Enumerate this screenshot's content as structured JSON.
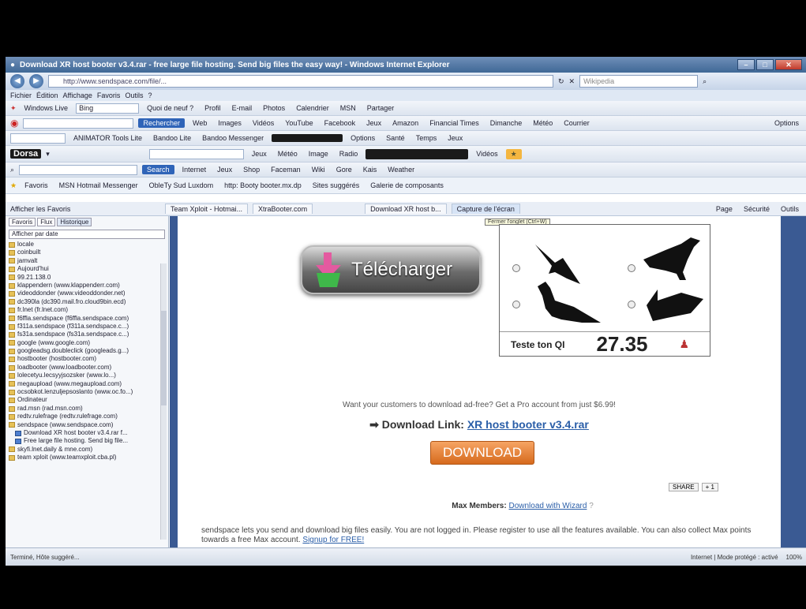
{
  "window": {
    "title": "Download XR host booter v3.4.rar - free large file hosting. Send big files the easy way! - Windows Internet Explorer",
    "controls": [
      "–",
      "□",
      "✕"
    ]
  },
  "address": {
    "url": "http://www.sendspace.com/file/...",
    "search_placeholder": "Wikipedia"
  },
  "menu": [
    "Fichier",
    "Édition",
    "Affichage",
    "Favoris",
    "Outils",
    "?"
  ],
  "toolbars": {
    "row1": [
      "Windows Live",
      "Bing",
      "Quoi de neuf ?",
      "Profil",
      "E-mail",
      "Photos",
      "Calendrier",
      "MSN",
      "Partager"
    ],
    "row2": [
      "Rechercher",
      "Web",
      "Images",
      "Vidéos",
      "YouTube",
      "Facebook",
      "Jeux",
      "Amazon",
      "Financial Times",
      "Dimanche",
      "Météo",
      "Courrier",
      "Options"
    ],
    "row3": [
      "ANIMATOR Tools Lite",
      "Bandoo Lite",
      "Bandoo Messenger",
      "Options",
      "Santé",
      "Temps",
      "Jeux"
    ],
    "brand": "Dorsa",
    "row4": [
      "Jeux",
      "Météo",
      "Image",
      "Radio",
      "Vidéos"
    ],
    "row5": [
      "Search",
      "Internet",
      "Jeux",
      "Shop",
      "Faceman",
      "Wiki",
      "Gore",
      "Kais",
      "Weather"
    ]
  },
  "favorites_bar": {
    "label": "Favoris",
    "items": [
      "MSN Hotmail Messenger",
      "ObleTy Sud Luxdom",
      "http: Booty booter.mx.dp",
      "Sites suggérés",
      "Galerie de composants"
    ]
  },
  "tabs": [
    "Team Xploit - Hotmai...",
    "XtraBooter.com",
    "Download XR host b...",
    "Capture de l'écran"
  ],
  "tab_actions": [
    "Page",
    "Sécurité",
    "Outils"
  ],
  "tooltip": "Fermer l'onglet (Ctrl+W)",
  "sidebar": {
    "title": "Afficher les Favoris",
    "tabs": [
      "Favoris",
      "Flux",
      "Historique"
    ],
    "view": "Afficher par date",
    "history": [
      {
        "text": "locale",
        "type": "folder"
      },
      {
        "text": "coinbuilt",
        "type": "folder"
      },
      {
        "text": "jamvalt",
        "type": "folder"
      },
      {
        "text": "Aujourd'hui",
        "type": "folder"
      },
      {
        "text": "99.21.138.0",
        "type": "folder"
      },
      {
        "text": "klappendern (www.klappenderr.com)",
        "type": "folder"
      },
      {
        "text": "videoddonder (www.videoddonder.net)",
        "type": "folder"
      },
      {
        "text": "dc390la (dc390.mail.fro.cloud9bin.ecd)",
        "type": "folder"
      },
      {
        "text": "fr.lnet (fr.lnet.com)",
        "type": "folder"
      },
      {
        "text": "f6ffla.sendspace (f6ffla.sendspace.com)",
        "type": "folder"
      },
      {
        "text": "f311a.sendspace (f311a.sendspace.c...)",
        "type": "folder"
      },
      {
        "text": "fs31a.sendspace (fs31a.sendspace.c...)",
        "type": "folder"
      },
      {
        "text": "google (www.google.com)",
        "type": "folder"
      },
      {
        "text": "googleadsg.doubleclick (googleads.g...)",
        "type": "folder"
      },
      {
        "text": "hostbooter (hostbooter.com)",
        "type": "folder"
      },
      {
        "text": "loadbooter (www.loadbooter.com)",
        "type": "folder"
      },
      {
        "text": "lolecetyu.lecsyyjsozsker (www.lo...)",
        "type": "folder"
      },
      {
        "text": "megaupload (www.megaupload.com)",
        "type": "folder"
      },
      {
        "text": "ocsobkot.lenzuljepsoslanto (www.oc.fo...)",
        "type": "folder"
      },
      {
        "text": "Ordinateur",
        "type": "folder"
      },
      {
        "text": "rad.msn (rad.msn.com)",
        "type": "folder"
      },
      {
        "text": "redtv.rulefrage (redtv.rulefrage.com)",
        "type": "folder"
      },
      {
        "text": "sendspace (www.sendspace.com)",
        "type": "folder"
      },
      {
        "text": "Download XR host booter v3.4.rar f...",
        "type": "page"
      },
      {
        "text": "Free large file hosting. Send big file...",
        "type": "page"
      },
      {
        "text": "skyfi.lnet.daily & mne.com)",
        "type": "folder"
      },
      {
        "text": "team xploit (www.teamxploit.cba.pl)",
        "type": "folder"
      }
    ],
    "status": "Terminé, Hôte suggéré..."
  },
  "page": {
    "telecharger_label": "Télécharger",
    "captcha_label": "Teste ton QI",
    "captcha_score": "27.35",
    "promo_text": "Want your customers to download ad-free? Get a Pro account from just $6.99!",
    "download_prefix": "➡ Download Link:",
    "download_link": "XR host booter v3.4.rar",
    "download_button": "DOWNLOAD",
    "share_label": "SHARE",
    "share_count": "+ 1",
    "max_members_label": "Max Members:",
    "max_members_link": "Download with Wizard",
    "bottom_text": "sendspace lets you send and download big files easily. You are not logged in. Please register to use all the features available. You can also collect Max points towards a free Max account.",
    "signup_link": "Signup for FREE!"
  },
  "status": {
    "zone": "Internet | Mode protégé : activé",
    "zoom": "100%"
  }
}
